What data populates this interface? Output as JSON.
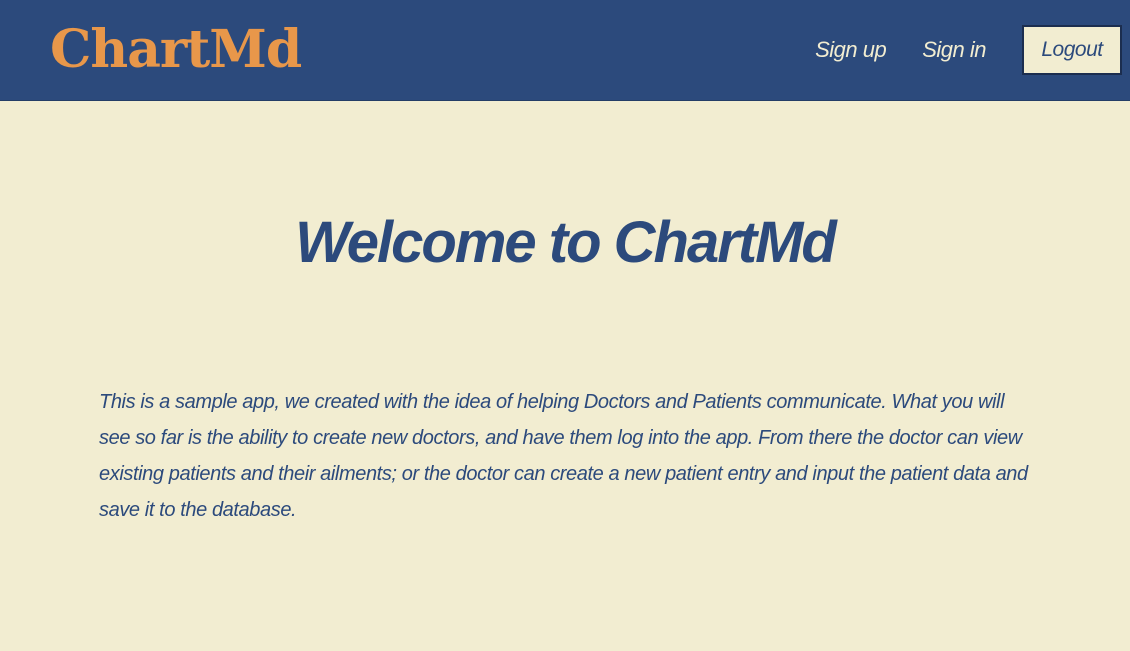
{
  "header": {
    "logo": "ChartMd",
    "nav": {
      "sign_up": "Sign up",
      "sign_in": "Sign in",
      "logout": "Logout"
    }
  },
  "main": {
    "title": "Welcome to ChartMd",
    "intro": "This is a sample app, we created with the idea of helping Doctors and Patients communicate. What you will see so far is the ability to create new doctors, and have them log into the app. From there the doctor can view existing patients and their ailments; or the doctor can create a new patient entry and input the patient data and save it to the database."
  },
  "colors": {
    "header_bg": "#2c4a7c",
    "page_bg": "#f2edd1",
    "logo": "#e8974a",
    "text": "#2c4a7c"
  }
}
